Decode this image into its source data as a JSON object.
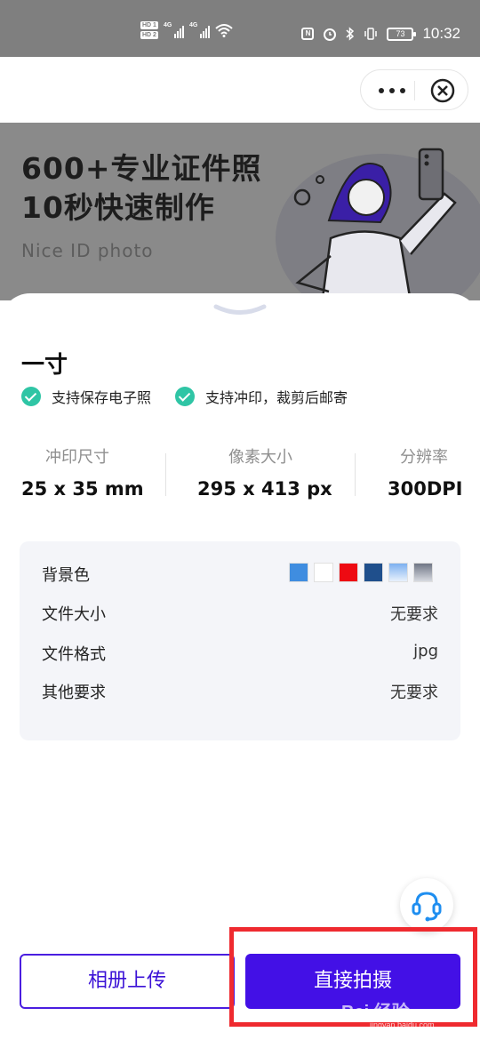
{
  "status_bar": {
    "time": "10:32",
    "battery": "73",
    "network_labels": [
      "HD 1",
      "HD 2"
    ],
    "signal_label": "4G"
  },
  "banner": {
    "title_line1": "600+专业证件照",
    "title_line2": "10秒快速制作",
    "subtitle": "Nice ID photo"
  },
  "sheet": {
    "title": "一寸",
    "features": [
      "支持保存电子照",
      "支持冲印，裁剪后邮寄"
    ],
    "stats": [
      {
        "label": "冲印尺寸",
        "value": "25 x 35 mm"
      },
      {
        "label": "像素大小",
        "value": "295 x 413 px"
      },
      {
        "label": "分辨率",
        "value": "300DPI"
      }
    ],
    "specs": {
      "background_label": "背景色",
      "background_colors": [
        "#3f8de0",
        "#ffffff",
        "#ee0a12",
        "#1f4f8c",
        "gradient-blue",
        "gradient-gray"
      ],
      "file_size_label": "文件大小",
      "file_size_value": "无要求",
      "file_format_label": "文件格式",
      "file_format_value": "jpg",
      "other_label": "其他要求",
      "other_value": "无要求"
    }
  },
  "buttons": {
    "upload": "相册上传",
    "shoot": "直接拍摄"
  },
  "watermark": {
    "brand": "Bai 经验",
    "url": "jingyan.baidu.com"
  },
  "colors": {
    "accent": "#4310e6",
    "check": "#2fc5a5",
    "highlight": "#ef2a2f"
  }
}
